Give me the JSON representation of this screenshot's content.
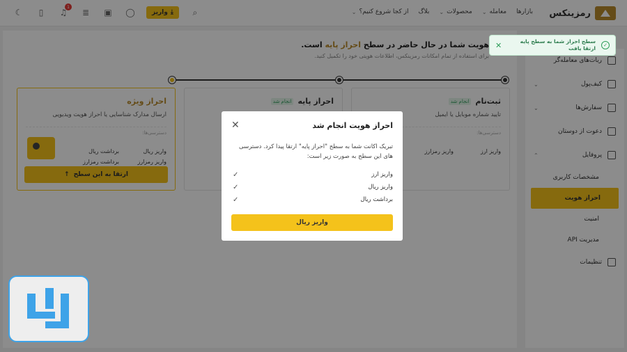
{
  "topbar": {
    "logo_text": "رمزینکس",
    "nav": [
      "بازارها",
      "معامله",
      "محصولات",
      "بلاگ",
      "از کجا شروع کنیم؟"
    ],
    "deposit_label": "واریز",
    "notification_count": "1"
  },
  "content": {
    "headline_pre": "هویت شما در حال حاضر در سطح",
    "headline_level": "احراز پایه",
    "headline_post": "است.",
    "subline": "برای استفاده از تمام امکانات رمزینکس، اطلاعات هویتی خود را تکمیل کنید.",
    "cards": [
      {
        "title": "ثبت‌نام",
        "tag": "انجام شد",
        "desc": "تایید شماره موبایل یا ایمیل",
        "access": "دسترسی‌ها:",
        "features": [
          "واریز ارز",
          "واریز رمزارز"
        ]
      },
      {
        "title": "احراز پایه",
        "tag": "انجام شد",
        "desc": "",
        "access": "",
        "features": []
      },
      {
        "title": "احراز ویژه",
        "tag": "",
        "desc": "ارسال مدارک شناسایی یا احراز هویت ویدیویی",
        "access": "دسترسی‌ها:",
        "features": [
          "واریز ریال",
          "برداشت ریال",
          "واریز رمزارز",
          "برداشت رمزارز"
        ],
        "button": "ارتقا به این سطح"
      }
    ]
  },
  "sidebar": {
    "items": [
      {
        "label": "ربات‌های معامله‌گر"
      },
      {
        "label": "کیف‌پول"
      },
      {
        "label": "سفارش‌ها"
      },
      {
        "label": "دعوت از دوستان"
      },
      {
        "label": "پروفایل"
      }
    ],
    "profile_sub": [
      "مشخصات کاربری",
      "احراز هویت",
      "امنیت",
      "مدیریت API"
    ],
    "settings": "تنظیمات"
  },
  "modal": {
    "title": "احراز هویت انجام شد",
    "body": "تبریک اکانت شما به سطح \"احراز پایه\" ارتقا پیدا کرد. دسترسی های این سطح به صورت زیر است:",
    "checks": [
      "واریز ارز",
      "واریز ریال",
      "برداشت ریال"
    ],
    "button": "واریز ریال"
  },
  "toast": {
    "text": "سطح احراز شما به سطح پایه ارتقا یافت"
  },
  "colors": {
    "accent": "#f4c21b",
    "brand": "#b98a2c",
    "success": "#2e9d5a"
  }
}
